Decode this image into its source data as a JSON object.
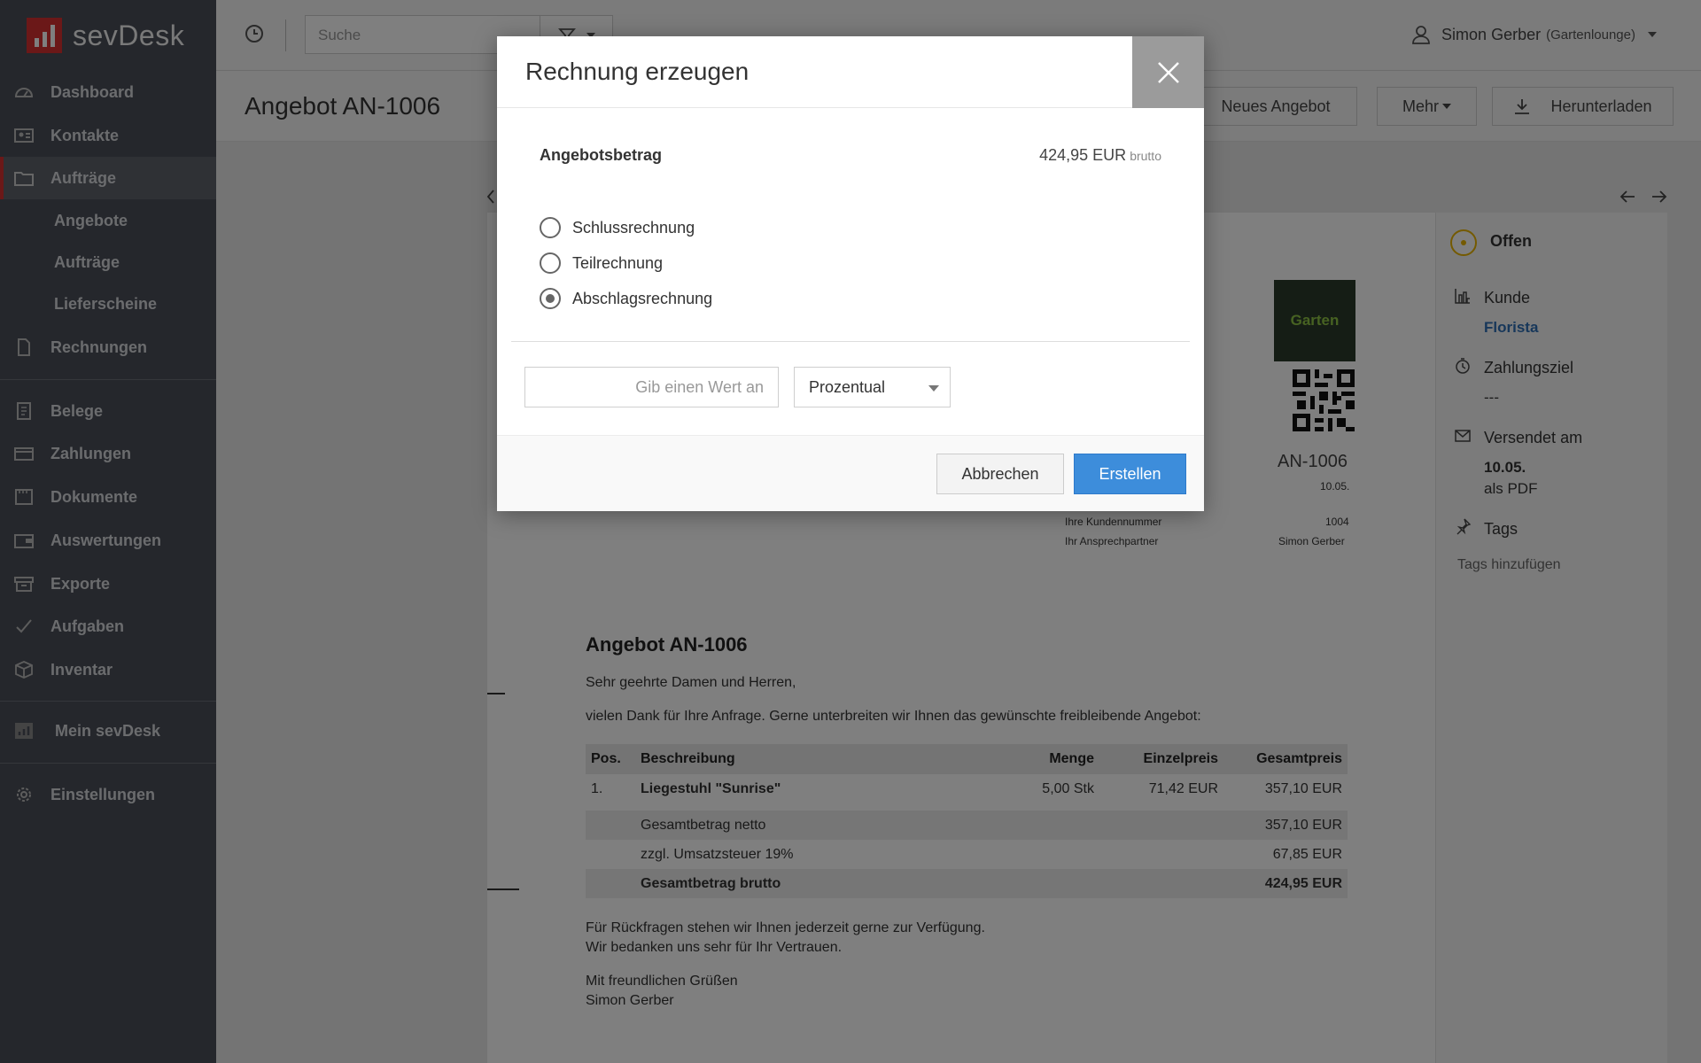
{
  "app": {
    "brand": "sevDesk"
  },
  "sidebar": {
    "items": [
      {
        "label": "Dashboard",
        "icon": "dashboard-icon"
      },
      {
        "label": "Kontakte",
        "icon": "contacts-icon"
      },
      {
        "label": "Aufträge",
        "icon": "folder-icon",
        "active": true
      },
      {
        "label": "Rechnungen",
        "icon": "document-icon"
      },
      {
        "label": "Belege",
        "icon": "receipt-icon"
      },
      {
        "label": "Zahlungen",
        "icon": "card-icon"
      },
      {
        "label": "Dokumente",
        "icon": "file-icon"
      },
      {
        "label": "Auswertungen",
        "icon": "wallet-icon"
      },
      {
        "label": "Exporte",
        "icon": "archive-icon"
      },
      {
        "label": "Aufgaben",
        "icon": "check-icon"
      },
      {
        "label": "Inventar",
        "icon": "box-icon"
      },
      {
        "label": "Mein sevDesk",
        "icon": "chart-icon"
      },
      {
        "label": "Einstellungen",
        "icon": "gear-icon"
      }
    ],
    "subitems": [
      "Angebote",
      "Aufträge",
      "Lieferscheine"
    ]
  },
  "topbar": {
    "search_placeholder": "Suche",
    "user_name": "Simon Gerber",
    "user_company": "(Gartenlounge)"
  },
  "page": {
    "title": "Angebot AN-1006",
    "buttons": {
      "new_offer": "Neues Angebot",
      "more": "Mehr",
      "download": "Herunterladen"
    }
  },
  "status_panel": {
    "status": "Offen",
    "customer_label": "Kunde",
    "customer": "Florista",
    "payment_term_label": "Zahlungsziel",
    "payment_term": "---",
    "sent_label": "Versendet am",
    "sent_date": "10.05.",
    "sent_as": "als PDF",
    "tags_label": "Tags",
    "add_tags": "Tags hinzufügen"
  },
  "document": {
    "logo_text": "Garten",
    "number": "AN-1006",
    "date": "10.05.",
    "customer_number_label": "Ihre Kundennummer",
    "customer_number": "1004",
    "contact_label": "Ihr Ansprechpartner",
    "contact": "Simon Gerber",
    "title": "Angebot AN-1006",
    "greeting": "Sehr geehrte Damen und Herren,",
    "intro": "vielen Dank für Ihre Anfrage. Gerne unterbreiten wir Ihnen das gewünschte freibleibende Angebot:",
    "table": {
      "headers": [
        "Pos.",
        "Beschreibung",
        "Menge",
        "Einzelpreis",
        "Gesamtpreis"
      ],
      "rows": [
        [
          "1.",
          "Liegestuhl \"Sunrise\"",
          "5,00 Stk",
          "71,42 EUR",
          "357,10 EUR"
        ]
      ],
      "net_label": "Gesamtbetrag netto",
      "net": "357,10 EUR",
      "tax_label": "zzgl. Umsatzsteuer 19%",
      "tax": "67,85 EUR",
      "gross_label": "Gesamtbetrag brutto",
      "gross": "424,95 EUR"
    },
    "closing1": "Für Rückfragen stehen wir Ihnen jederzeit gerne zur Verfügung.",
    "closing2": "Wir bedanken uns sehr für Ihr Vertrauen.",
    "regards": "Mit freundlichen Grüßen",
    "signature": "Simon Gerber"
  },
  "modal": {
    "title": "Rechnung erzeugen",
    "amount_label": "Angebotsbetrag",
    "amount": "424,95 EUR",
    "amount_suffix": "brutto",
    "options": [
      "Schlussrechnung",
      "Teilrechnung",
      "Abschlagsrechnung"
    ],
    "selected_option": "Abschlagsrechnung",
    "value_placeholder": "Gib einen Wert an",
    "value": "",
    "unit": "Prozentual",
    "cancel": "Abbrechen",
    "create": "Erstellen"
  },
  "colors": {
    "brand": "#d63031",
    "primary": "#3d8ddb",
    "sidebar": "#4b4f58",
    "link": "#2f6fb5",
    "status": "#e8b400"
  }
}
